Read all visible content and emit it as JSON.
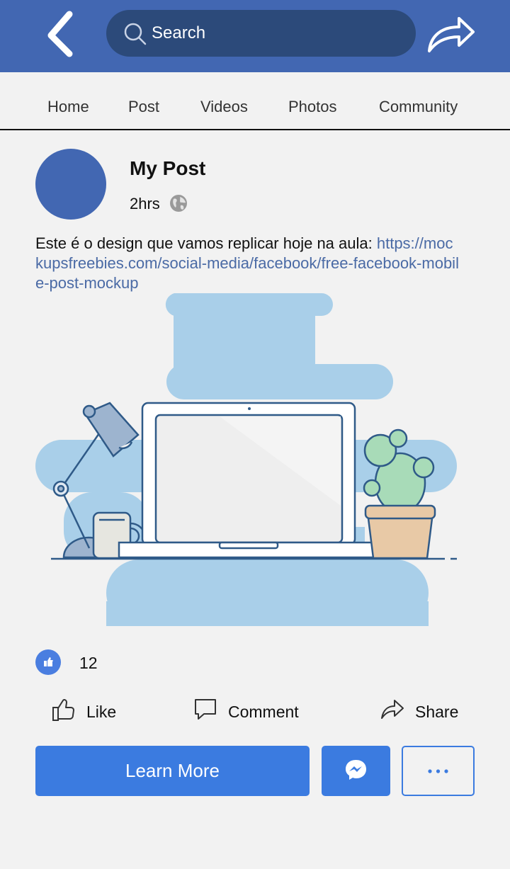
{
  "header": {
    "search_placeholder": "Search",
    "icons": {
      "back": "chevron-left-icon",
      "search": "search-icon",
      "share": "share-arrow-icon"
    },
    "color": "#4267b2"
  },
  "tabs": [
    {
      "label": "Home"
    },
    {
      "label": "Post"
    },
    {
      "label": "Videos"
    },
    {
      "label": "Photos"
    },
    {
      "label": "Community"
    }
  ],
  "post": {
    "title": "My Post",
    "time": "2hrs",
    "text": "Este é o design que vamos replicar hoje na aula: ",
    "link": "https://mockupsfreebies.com/social-media/facebook/free-facebook-mobile-post-mockup",
    "image_icon": "desk-laptop-illustration"
  },
  "reactions": {
    "count": "12",
    "icon": "thumbs-up-icon"
  },
  "actions": {
    "like": "Like",
    "comment": "Comment",
    "share": "Share"
  },
  "buttons": {
    "learn_more": "Learn More",
    "messenger_icon": "messenger-icon",
    "more_icon": "ellipsis-icon"
  },
  "colors": {
    "accent": "#3b7be0",
    "link": "#4a6aa5",
    "illustration_blue": "#a9cfe9"
  }
}
